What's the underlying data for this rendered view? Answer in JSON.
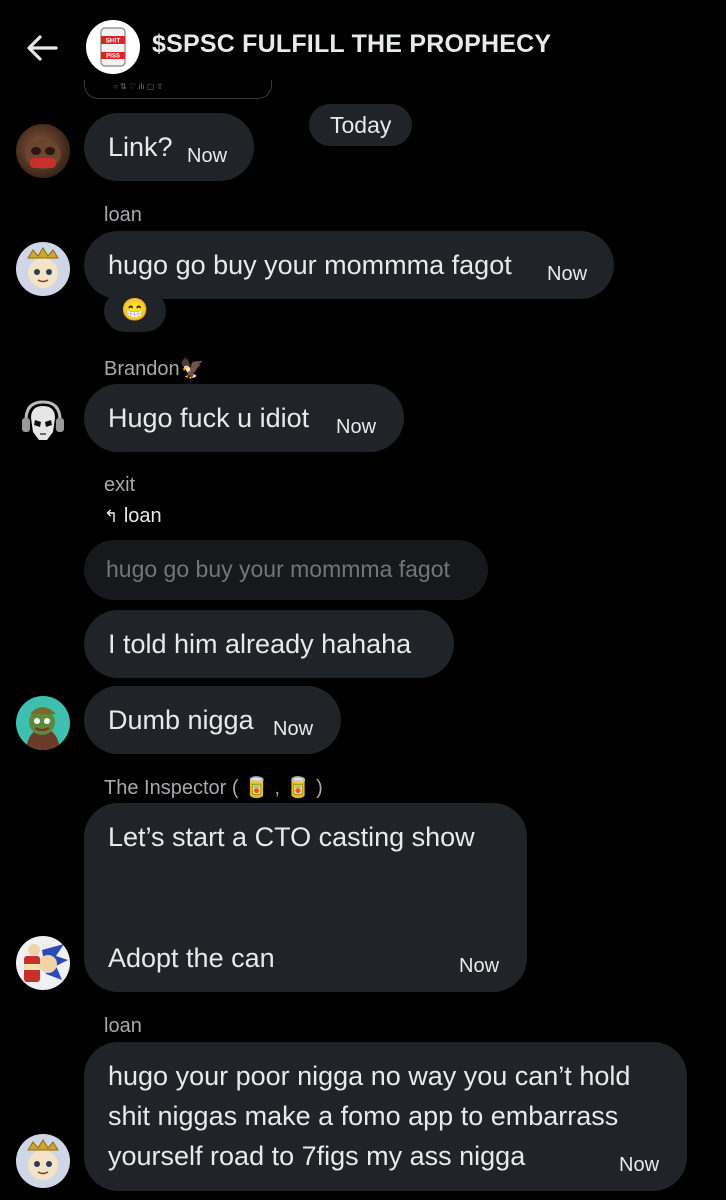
{
  "header": {
    "title": "$SPSC FULFILL THE PROPHECY",
    "group_avatar_text": "SHIT PISS"
  },
  "date_separator": "Today",
  "messages": [
    {
      "sender": "",
      "text": "Link?",
      "time": "Now",
      "avatar": "sloth-avatar"
    },
    {
      "sender": "loan",
      "text": "hugo go buy your mommma fagot",
      "time": "Now",
      "reaction": "😁",
      "avatar": "anime-crown-avatar"
    },
    {
      "sender": "Brandon🦅",
      "text": "Hugo fuck u idiot",
      "time": "Now",
      "avatar": "skull-headphones-avatar"
    },
    {
      "sender": "exit",
      "reply_to": "loan",
      "quoted": "hugo go buy your mommma fagot",
      "text": "I told him already hahaha"
    },
    {
      "sender": "",
      "text": "Dumb nigga",
      "time": "Now",
      "avatar": "pepe-avatar"
    },
    {
      "sender": "The Inspector ( 🥫 , 🥫 )",
      "line1": "Let’s start a CTO casting show",
      "line2": "Adopt the can",
      "time": "Now",
      "avatar": "sonic-avatar"
    },
    {
      "sender": "loan",
      "lines": [
        "hugo your poor nigga no way you can’t hold",
        "shit niggas make a fomo app to embarrass",
        "yourself road to 7figs my ass nigga"
      ],
      "time": "Now",
      "avatar": "anime-crown-avatar"
    }
  ],
  "reply_icon": "↰"
}
